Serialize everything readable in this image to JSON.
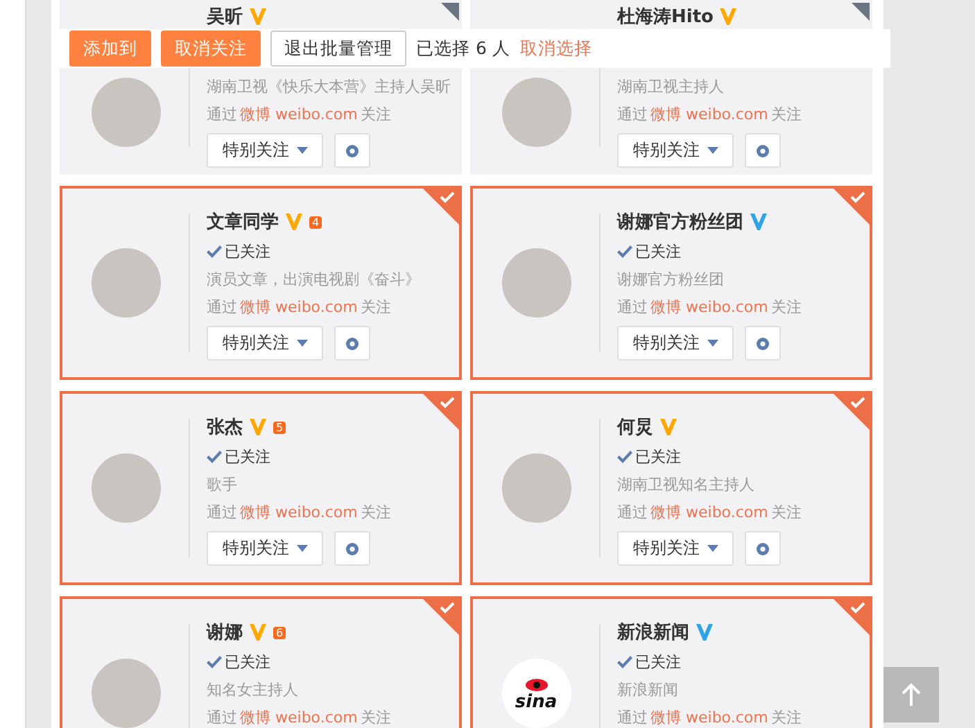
{
  "toolbar": {
    "buttons": [
      {
        "label": "添加到",
        "kind": "primary"
      },
      {
        "label": "取消关注",
        "kind": "primary"
      },
      {
        "label": "退出批量管理",
        "kind": "plain"
      }
    ],
    "selection_text": "已选择 6 人",
    "cancel_link": "取消选择"
  },
  "cards": [
    {
      "kind": "person",
      "name": "吴昕",
      "color": "#ffa800",
      "selected": false,
      "description": "湖南卫视《快乐大本营》主持人吴昕",
      "via_prefix": "通过",
      "via_source": "微博 weibo.com",
      "via_suffix": "关注",
      "special_button": "特别关注"
    },
    {
      "kind": "person",
      "name": "杜海涛Hito",
      "color": "#ffa800",
      "selected": false,
      "description": "湖南卫视主持人",
      "via_prefix": "通过",
      "via_source": "微博 weibo.com",
      "via_suffix": "关注",
      "special_button": "特别关注"
    },
    {
      "kind": "person",
      "name": "文章同学",
      "color": "#ffa800",
      "member_level": "4",
      "selected": true,
      "followed": "已关注",
      "description": "演员文章，出演电视剧《奋斗》",
      "via_prefix": "通过",
      "via_source": "微博 weibo.com",
      "via_suffix": "关注",
      "special_button": "特别关注"
    },
    {
      "kind": "person",
      "name": "谢娜官方粉丝团",
      "color": "#2fa3e6",
      "selected": true,
      "followed": "已关注",
      "description": "谢娜官方粉丝团",
      "via_prefix": "通过",
      "via_source": "微博 weibo.com",
      "via_suffix": "关注",
      "special_button": "特别关注"
    },
    {
      "kind": "person",
      "name": "张杰",
      "color": "#ffa800",
      "member_level": "5",
      "selected": true,
      "followed": "已关注",
      "description": "歌手",
      "via_prefix": "通过",
      "via_source": "微博 weibo.com",
      "via_suffix": "关注",
      "special_button": "特别关注"
    },
    {
      "kind": "person",
      "name": "何炅",
      "color": "#ffa800",
      "selected": true,
      "followed": "已关注",
      "description": "湖南卫视知名主持人",
      "via_prefix": "通过",
      "via_source": "微博 weibo.com",
      "via_suffix": "关注",
      "special_button": "特别关注"
    },
    {
      "kind": "person",
      "name": "谢娜",
      "color": "#ffa800",
      "member_level": "6",
      "selected": true,
      "followed": "已关注",
      "description": "知名女主持人",
      "via_prefix": "通过",
      "via_source": "微博 weibo.com",
      "via_suffix": "关注"
    },
    {
      "kind": "logo",
      "name": "新浪新闻",
      "color": "#2fa3e6",
      "selected": true,
      "logo_text": "sina",
      "followed": "已关注",
      "description": "新浪新闻",
      "via_prefix": "通过",
      "via_source": "微博 weibo.com",
      "via_suffix": "关注"
    }
  ]
}
